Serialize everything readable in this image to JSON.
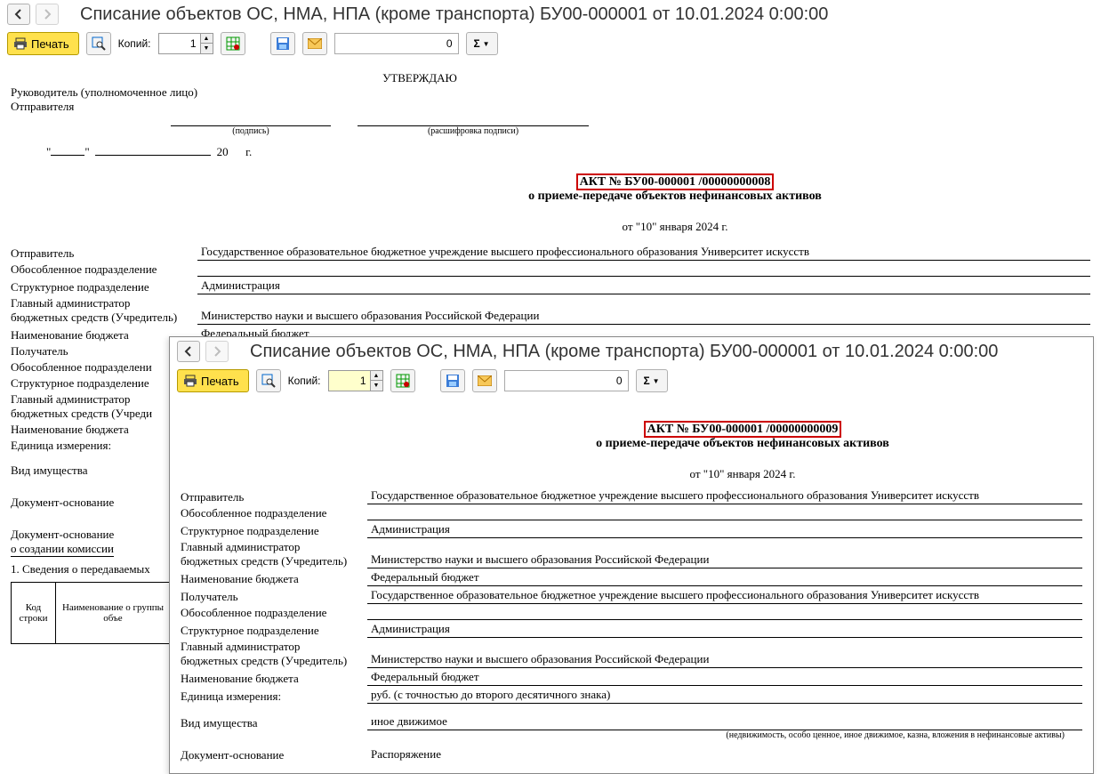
{
  "win1": {
    "title": "Списание объектов ОС, НМА, НПА (кроме транспорта) БУ00-000001 от 10.01.2024 0:00:00",
    "print_label": "Печать",
    "copies_label": "Копий:",
    "copies_value": "1",
    "sum_value": "0",
    "approve": "УТВЕРЖДАЮ",
    "leader_line1": "Руководитель (уполномоченное лицо)",
    "leader_line2": "Отправителя",
    "sig1": "(подпись)",
    "sig2": "(расшифровка подписи)",
    "date_year_label": "20",
    "date_g": "г.",
    "akt_no": "АКТ № БУ00-000001 /00000000008",
    "akt_sub": "о приеме-передаче объектов нефинансовых активов",
    "akt_date": "от \"10\" января 2024 г.",
    "rows": {
      "sender_lbl": "Отправитель",
      "sender_val": "Государственное образовательное бюджетное учреждение высшего профессионального образования Университет искусств",
      "obosob_lbl": "Обособленное подразделение",
      "obosob_val": "",
      "struct_lbl": "Структурное подразделение",
      "struct_val": "Администрация",
      "admin_lbl1": "Главный администратор",
      "admin_lbl2": "бюджетных средств (Учредитель)",
      "admin_val": "Министерство науки и высшего образования Российской Федерации",
      "budget_lbl": "Наименование бюджета",
      "budget_val": "Федеральный бюджет",
      "recv_lbl": "Получатель",
      "obosob2_lbl": "Обособленное подразделени",
      "struct2_lbl": "Структурное подразделение",
      "admin2_lbl1": "Главный администратор",
      "admin2_lbl2": "бюджетных средств (Учреди",
      "budget2_lbl": "Наименование бюджета",
      "unit_lbl": "Единица измерения:",
      "kind_lbl": "Вид имущества",
      "basis_lbl": "Документ-основание",
      "basis2_lbl1": "Документ-основание",
      "basis2_lbl2": "о создании комиссии",
      "section1": "1. Сведения о передаваемых",
      "th_code1": "Код",
      "th_code2": "строки",
      "th_name": "Наименование о группы объе"
    }
  },
  "win2": {
    "title": "Списание объектов ОС, НМА, НПА (кроме транспорта) БУ00-000001 от 10.01.2024 0:00:00",
    "print_label": "Печать",
    "copies_label": "Копий:",
    "copies_value": "1",
    "sum_value": "0",
    "akt_no": "АКТ № БУ00-000001 /00000000009",
    "akt_sub": "о приеме-передаче объектов нефинансовых активов",
    "akt_date": "от \"10\" января 2024 г.",
    "rows": {
      "sender_lbl": "Отправитель",
      "sender_val": "Государственное образовательное бюджетное учреждение высшего профессионального образования Университет искусств",
      "obosob_lbl": "Обособленное подразделение",
      "obosob_val": "",
      "struct_lbl": "Структурное подразделение",
      "struct_val": "Администрация",
      "admin_lbl1": "Главный администратор",
      "admin_lbl2": "бюджетных средств (Учредитель)",
      "admin_val": "Министерство науки и высшего образования Российской Федерации",
      "budget_lbl": "Наименование бюджета",
      "budget_val": "Федеральный бюджет",
      "recv_lbl": "Получатель",
      "recv_val": "Государственное образовательное бюджетное учреждение высшего профессионального образования Университет искусств",
      "obosob2_lbl": "Обособленное подразделение",
      "obosob2_val": "",
      "struct2_lbl": "Структурное подразделение",
      "struct2_val": "Администрация",
      "admin2_lbl1": "Главный администратор",
      "admin2_lbl2": "бюджетных средств (Учредитель)",
      "admin2_val": "Министерство науки и высшего образования Российской Федерации",
      "budget2_lbl": "Наименование бюджета",
      "budget2_val": "Федеральный бюджет",
      "unit_lbl": "Единица измерения:",
      "unit_val": "  руб. (с точностью до второго десятичного знака)",
      "kind_lbl": "Вид имущества",
      "kind_val": "иное движимое",
      "kind_note": "(недвижимость, особо ценное, иное движимое, казна, вложения в нефинансовые активы)",
      "basis_lbl": "Документ-основание",
      "basis_val": "Распоряжение"
    }
  }
}
